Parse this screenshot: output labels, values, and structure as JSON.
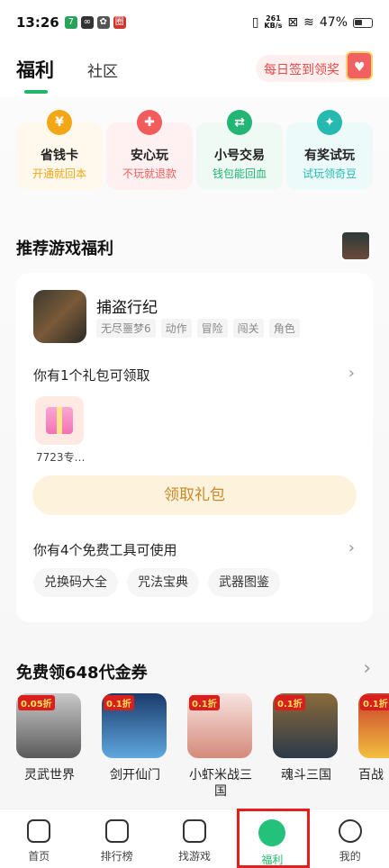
{
  "status_bar": {
    "time": "13:26",
    "net_speed": "261",
    "net_unit": "KB/s",
    "battery": "47%"
  },
  "header": {
    "tab_active": "福利",
    "tab_other": "社区",
    "checkin_label": "每日签到领奖"
  },
  "feature_cards": [
    {
      "title": "省钱卡",
      "subtitle": "开通就回本",
      "icon": "coin-icon",
      "color": "#f3a716",
      "bg": "#fff8ec"
    },
    {
      "title": "安心玩",
      "subtitle": "不玩就退款",
      "icon": "gamepad-icon",
      "color": "#f25c5c",
      "bg": "#fff1f1"
    },
    {
      "title": "小号交易",
      "subtitle": "钱包能回血",
      "icon": "exchange-icon",
      "color": "#22b573",
      "bg": "#eefaf3"
    },
    {
      "title": "有奖试玩",
      "subtitle": "试玩领奇豆",
      "icon": "gift-icon",
      "color": "#25b9b0",
      "bg": "#ecfaf9"
    }
  ],
  "recommend": {
    "title": "推荐游戏福利",
    "game_name": "捕盗行纪",
    "tags": [
      "无尽噩梦6",
      "动作",
      "冒险",
      "闯关",
      "角色"
    ],
    "gift_row_label": "你有1个礼包可领取",
    "gift_name": "7723专…",
    "claim_button": "领取礼包",
    "tools_row_label": "你有4个免费工具可使用",
    "tools": [
      "兑换码大全",
      "咒法宝典",
      "武器图鉴"
    ]
  },
  "coupons": {
    "title": "免费领648代金券",
    "games": [
      {
        "name": "灵武世界",
        "badge": "0.05折",
        "bg": "linear-gradient(#c9c9c9,#5a5a5a)"
      },
      {
        "name": "剑开仙门",
        "badge": "0.1折",
        "bg": "linear-gradient(#1a3a6b,#5fa8e0)"
      },
      {
        "name": "小虾米战三国",
        "badge": "0.1折",
        "bg": "linear-gradient(#f7e3e0,#d48a7a)"
      },
      {
        "name": "魂斗三国",
        "badge": "0.1折",
        "bg": "linear-gradient(#8a6a3a,#2c3a4a)"
      },
      {
        "name": "百战",
        "badge": "0.1折",
        "bg": "linear-gradient(#c83a2a,#f3c040)"
      }
    ]
  },
  "nav": [
    {
      "label": "首页",
      "icon": "home-icon"
    },
    {
      "label": "排行榜",
      "icon": "ranking-icon"
    },
    {
      "label": "找游戏",
      "icon": "gamepad-icon"
    },
    {
      "label": "福利",
      "icon": "welfare-icon"
    },
    {
      "label": "我的",
      "icon": "profile-icon"
    }
  ]
}
